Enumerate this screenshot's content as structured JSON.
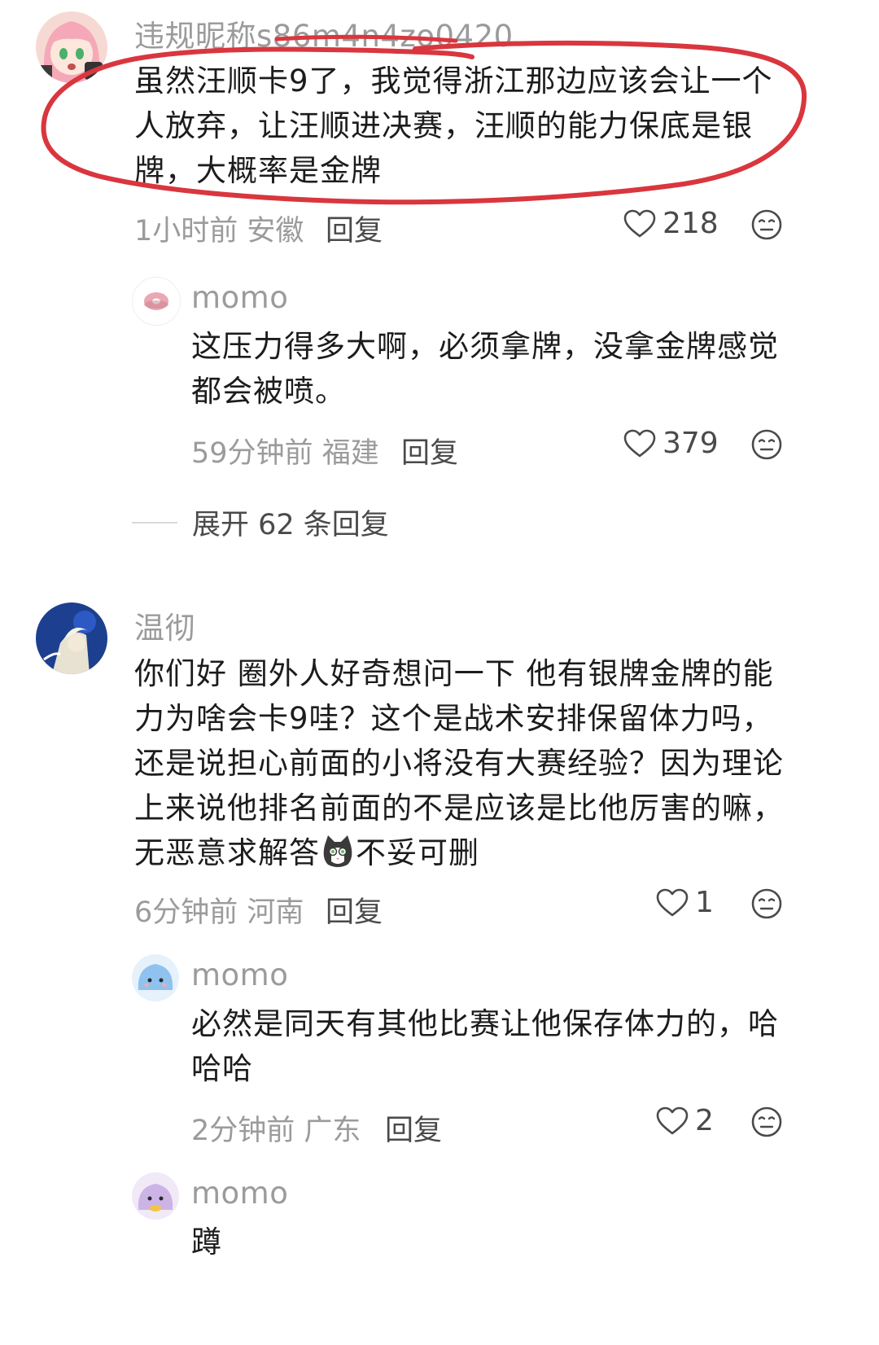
{
  "comments": [
    {
      "username": "违规昵称s86m4n4zo0420",
      "text": "虽然汪顺卡9了，我觉得浙江那边应该会让一个人放弃，让汪顺进决赛，汪顺的能力保底是银牌，大概率是金牌",
      "time": "1小时前",
      "location": "安徽",
      "reply_label": "回复",
      "likes": "218",
      "avatar_icon": "anime-girl-avatar",
      "replies": [
        {
          "username": "momo",
          "text": "这压力得多大啊，必须拿牌，没拿金牌感觉都会被喷。",
          "time": "59分钟前",
          "location": "福建",
          "reply_label": "回复",
          "likes": "379",
          "avatar_icon": "donut-avatar"
        }
      ],
      "expand_label": "展开 62 条回复"
    },
    {
      "username": "温彻",
      "text_before_emoji": "你们好 圈外人好奇想问一下 他有银牌金牌的能力为啥会卡9哇？这个是战术安排保留体力吗，还是说担心前面的小将没有大赛经验？因为理论上来说他排名前面的不是应该是比他厉害的嘛，无恶意求解答",
      "text_after_emoji": "不妥可删",
      "inline_emoji": "cat-face-emoji",
      "time": "6分钟前",
      "location": "河南",
      "reply_label": "回复",
      "likes": "1",
      "avatar_icon": "anime-boy-blue-avatar",
      "replies": [
        {
          "username": "momo",
          "text": "必然是同天有其他比赛让他保存体力的，哈哈哈",
          "time": "2分钟前",
          "location": "广东",
          "reply_label": "回复",
          "likes": "2",
          "avatar_icon": "blue-blob-avatar"
        },
        {
          "username": "momo",
          "text": "蹲",
          "avatar_icon": "purple-blob-avatar"
        }
      ]
    }
  ],
  "colors": {
    "annotation_circle": "#d9363e",
    "meta_gray": "#9b9b9b",
    "text": "#1c1c1c"
  }
}
